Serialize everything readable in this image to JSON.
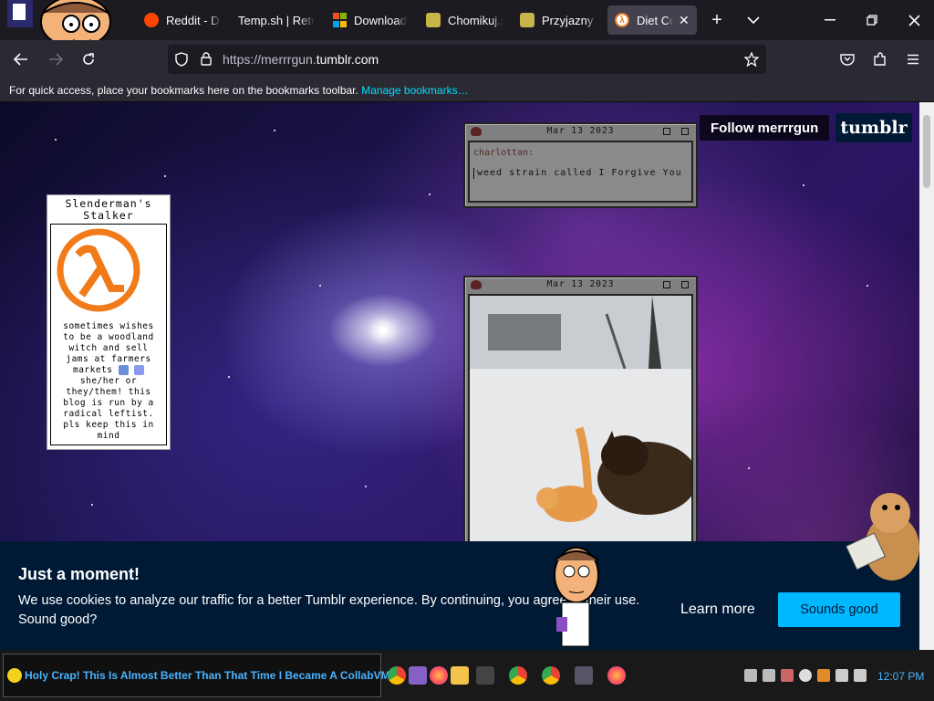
{
  "browser": {
    "tabs": [
      {
        "title": "r",
        "favicon": "profile-icon",
        "color": "#222",
        "active": false
      },
      {
        "title": "Reddit - Dive into anything",
        "favicon": "reddit-icon",
        "color": "#ff4500",
        "active": false
      },
      {
        "title": "Temp.sh | Retro",
        "favicon": "none",
        "color": "",
        "active": false
      },
      {
        "title": "Download",
        "favicon": "windows-icon",
        "color": "#0078d4",
        "active": false
      },
      {
        "title": "Chomikuj.pl",
        "favicon": "chomikuj-icon",
        "color": "#c9b44a",
        "active": false
      },
      {
        "title": "Przyjazny dysk",
        "favicon": "chomikuj-icon",
        "color": "#c9b44a",
        "active": false
      },
      {
        "title": "Diet Coke",
        "favicon": "lambda-icon",
        "color": "#e67e22",
        "active": true
      }
    ],
    "url_prefix": "https://merrrgun.",
    "url_domain": "tumblr.com",
    "bookmarks_text": "For quick access, place your bookmarks here on the bookmarks toolbar.",
    "bookmarks_link": "Manage bookmarks…"
  },
  "page": {
    "follow_label": "Follow merrrgun",
    "logo_text": "tumblr",
    "sidebar": {
      "name": "Slenderman's Stalker",
      "description": "sometimes wishes to be a woodland witch and sell jams at farmers markets",
      "description2": "she/her or they/them! this blog is run by a radical leftist. pls keep this in mind"
    },
    "posts": [
      {
        "date": "Mar 13 2023",
        "user": "charlottan:",
        "text": "weed strain called I Forgive You"
      },
      {
        "date": "Mar 13 2023",
        "media": "image of a cat and dog playing in snow"
      }
    ]
  },
  "cookie_banner": {
    "title": "Just a moment!",
    "text": "We use cookies to analyze our traffic for a better Tumblr experience. By continuing, you agree to their use. Sound good?",
    "learn_more": "Learn more",
    "accept": "Sounds good"
  },
  "taskbar": {
    "window_title": "Holy Crap! This Is Almost Better Than That Time I Became A CollabVM!",
    "time": "12:07 PM",
    "apps": [
      "chrome-icon",
      "visual-studio-icon",
      "firefox-icon",
      "file-explorer-icon",
      "app-icon",
      "chrome-icon",
      "chrome-icon",
      "app-icon",
      "firefox-icon"
    ]
  },
  "colors": {
    "tumblr_navy": "#001935",
    "tumblr_blue": "#00b8ff",
    "firefox_link": "#00ddff"
  }
}
